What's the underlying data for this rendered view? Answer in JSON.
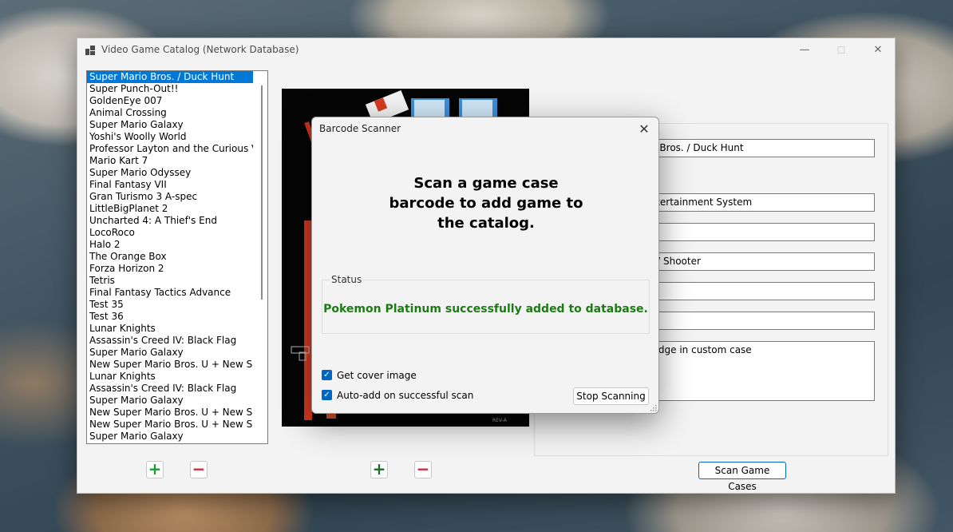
{
  "window": {
    "title": "Video Game Catalog (Network Database)",
    "minimize": "—",
    "maximize": "☐",
    "close": "✕"
  },
  "games": [
    "Super Mario Bros. / Duck Hunt",
    "Super Punch-Out!!",
    "GoldenEye 007",
    "Animal Crossing",
    "Super Mario Galaxy",
    "Yoshi's Woolly World",
    "Professor Layton and the Curious Villag",
    "Mario Kart 7",
    "Super Mario Odyssey",
    "Final Fantasy VII",
    "Gran Turismo 3 A-spec",
    "LittleBigPlanet 2",
    "Uncharted 4: A Thief's End",
    "LocoRoco",
    "Halo 2",
    "The Orange Box",
    "Forza Horizon 2",
    "Tetris",
    "Final Fantasy Tactics Advance",
    "Test 35",
    "Test 36",
    "Lunar Knights",
    "Assassin's Creed IV: Black Flag",
    "Super Mario Galaxy",
    "New Super Mario Bros. U + New Super I",
    "Lunar Knights",
    "Assassin's Creed IV: Black Flag",
    "Super Mario Galaxy",
    "New Super Mario Bros. U + New Super I",
    "New Super Mario Bros. U + New Super I",
    "Super Mario Galaxy"
  ],
  "selected_index": 0,
  "buttons": {
    "add_game": "+",
    "remove_game": "−",
    "add_cover": "+",
    "remove_cover": "−",
    "scan": "Scan Game Cases"
  },
  "details": {
    "title_value": "rio Bros. / Duck Hunt",
    "platform_value": "Entertainment System",
    "field3_value": "",
    "genre_value": "er / Shooter",
    "field5_value": "",
    "field6_value": "",
    "notes_value": "rtridge in custom case"
  },
  "cover": {
    "letter": "S",
    "rev": "REV-A"
  },
  "dialog": {
    "title": "Barcode Scanner",
    "close": "✕",
    "heading": [
      "Scan a game case",
      "barcode to add game to",
      "the catalog."
    ],
    "status_label": "Status",
    "status_text": "Pokemon Platinum successfully added to database.",
    "status_color": "#1e7a16",
    "checkbox_cover": "Get cover image",
    "checkbox_cover_checked": true,
    "checkbox_autoadd": "Auto-add on successful scan",
    "checkbox_autoadd_checked": true,
    "stop_button": "Stop Scanning",
    "check_glyph": "✓"
  }
}
